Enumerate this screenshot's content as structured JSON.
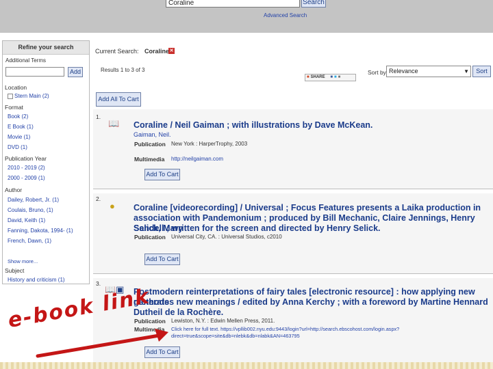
{
  "search": {
    "value": "Coraline",
    "button_label": "Search",
    "advanced_label": "Advanced Search"
  },
  "sidebar": {
    "title": "Refine your search",
    "additional_terms_label": "Additional Terms",
    "add_label": "Add",
    "location": {
      "heading": "Location",
      "items": [
        "Stern Main (2)"
      ]
    },
    "format": {
      "heading": "Format",
      "items": [
        "Book (2)",
        "E Book (1)",
        "Movie (1)",
        "DVD (1)"
      ]
    },
    "pubyear": {
      "heading": "Publication Year",
      "items": [
        "2010 - 2019 (2)",
        "2000 - 2009 (1)"
      ]
    },
    "author": {
      "heading": "Author",
      "items": [
        "Dailey, Robert, Jr. (1)",
        "Coulais, Bruno, (1)",
        "David, Keith (1)",
        "Fanning, Dakota, 1994- (1)",
        "French, Dawn, (1)"
      ]
    },
    "show_more": "Show more...",
    "subject": {
      "heading": "Subject",
      "items": [
        "History and criticism (1)"
      ]
    }
  },
  "current_search": {
    "label": "Current Search:",
    "term": "Coraline",
    "remove_glyph": "✕"
  },
  "results_count": "Results 1 to 3 of 3",
  "share": {
    "label": "SHARE"
  },
  "sort": {
    "label": "Sort by",
    "selected": "Relevance",
    "button_label": "Sort"
  },
  "add_all_label": "Add All To Cart",
  "results": [
    {
      "num": "1.",
      "icon": "book-icon",
      "title_lines": [
        "Coraline / Neil Gaiman ; with illustrations by Dave McKean."
      ],
      "author": "Gaiman, Neil.",
      "publication_label": "Publication",
      "publication": "New York : HarperTrophy, 2003",
      "multimedia_label": "Multimedia",
      "multimedia": "http://neilgaiman.com",
      "cart_label": "Add To Cart"
    },
    {
      "num": "2.",
      "icon": "dvd-icon",
      "title_lines": [
        "Coraline [videorecording] / Universal ; Focus Features presents a Laika production in",
        "association with Pandemonium ; produced by Bill Mechanic, Claire Jennings, Henry Selick, Mary",
        "Sandell ; written for the screen and directed by Henry Selick."
      ],
      "publication_label": "Publication",
      "publication": "Universal City, CA. : Universal Studios, c2010",
      "cart_label": "Add To Cart"
    },
    {
      "num": "3.",
      "icon": "ebook-icon",
      "title_lines": [
        "Postmodern reinterpretations of fairy tales [electronic resource] : how applying new methods",
        "generates new meanings / edited by Anna Kerchy ; with a foreword by Martine Hennard",
        "Dutheil de la Rochère."
      ],
      "publication_label": "Publication",
      "publication": "Lewiston, N.Y. : Edwin Mellen Press, 2011.",
      "multimedia_label": "Multimedia",
      "multimedia_lines": [
        "Click here for full text. https://vpllib002.nyu.edu:9443/login?url=http://search.ebscohost.com/login.aspx?",
        "direct=true&scope=site&db=nlebk&db=nlabk&AN=463795"
      ],
      "cart_label": "Add To Cart"
    }
  ],
  "overlay": {
    "label": "e-book link",
    "color": "#c41616"
  },
  "colors": {
    "link": "#2342a8",
    "title": "#1a3b8a",
    "button_bg": "#dfe6f5",
    "top_band": "#c4c4c4"
  }
}
